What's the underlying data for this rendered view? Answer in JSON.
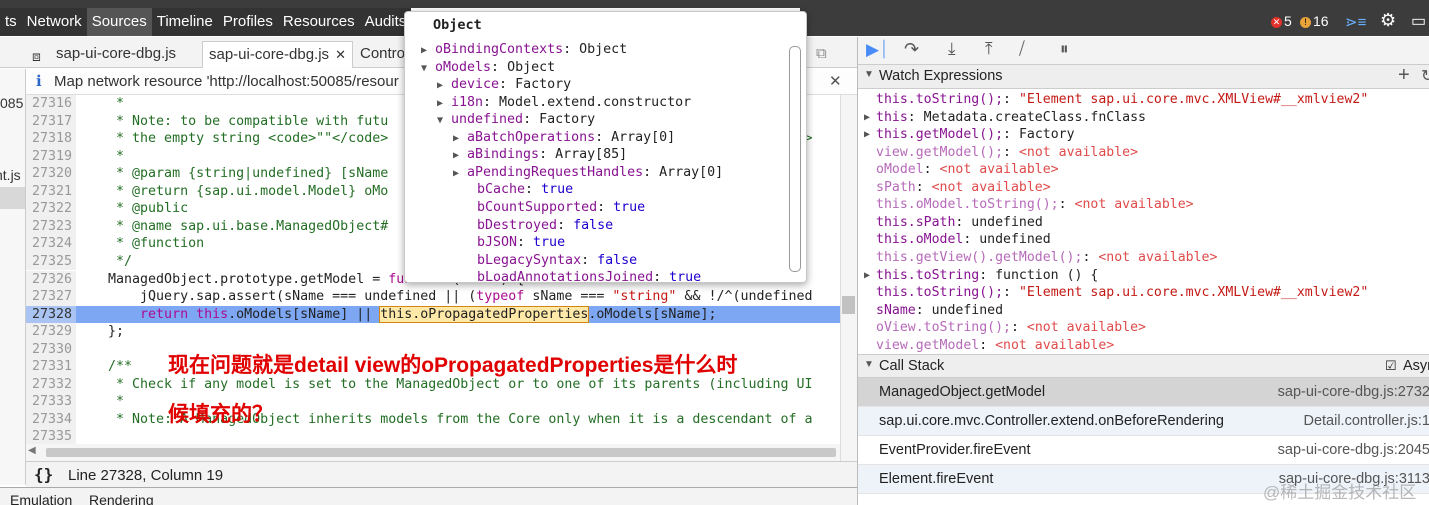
{
  "devtools": {
    "tabs": [
      {
        "label": "ts"
      },
      {
        "label": "Network"
      },
      {
        "label": "Sources"
      },
      {
        "label": "Timeline"
      },
      {
        "label": "Profiles"
      },
      {
        "label": "Resources"
      },
      {
        "label": "Audits"
      }
    ],
    "errors_count": "5",
    "warnings_count": "16"
  },
  "editor": {
    "file_tabs": [
      {
        "label": "sap-ui-core-dbg.js"
      },
      {
        "label": "sap-ui-core-dbg.js"
      },
      {
        "label": "Contro"
      }
    ],
    "infobar_text": "Map network resource 'http://localhost:50085/resour",
    "navigator_fragments": [
      "085",
      "nt.js"
    ],
    "status_text": "Line 27328, Column 19",
    "format_label": "{}",
    "drawer_tabs": [
      "Emulation",
      "Rendering"
    ]
  },
  "code_lines": [
    {
      "n": "27316",
      "parts": [
        [
          "c-com",
          "     *"
        ]
      ]
    },
    {
      "n": "27317",
      "parts": [
        [
          "c-com",
          "     * Note: to be compatible with futu"
        ],
        [
          "c-com",
          "                                                e th"
        ]
      ]
    },
    {
      "n": "27318",
      "parts": [
        [
          "c-com",
          "     * the empty string <code>\"\"</code>"
        ],
        [
          "c-com",
          "                                                code>"
        ]
      ]
    },
    {
      "n": "27319",
      "parts": [
        [
          "c-com",
          "     *"
        ]
      ]
    },
    {
      "n": "27320",
      "parts": [
        [
          "c-com",
          "     * @param {string|undefined} [sName"
        ]
      ]
    },
    {
      "n": "27321",
      "parts": [
        [
          "c-com",
          "     * @return {sap.ui.model.Model} oMo"
        ]
      ]
    },
    {
      "n": "27322",
      "parts": [
        [
          "c-com",
          "     * @public"
        ]
      ]
    },
    {
      "n": "27323",
      "parts": [
        [
          "c-com",
          "     * @name sap.ui.base.ManagedObject#"
        ]
      ]
    },
    {
      "n": "27324",
      "parts": [
        [
          "c-com",
          "     * @function"
        ]
      ]
    },
    {
      "n": "27325",
      "parts": [
        [
          "c-com",
          "     */"
        ]
      ]
    },
    {
      "n": "27326",
      "parts": [
        [
          "c-def",
          "    ManagedObject.prototype.getModel = "
        ],
        [
          "c-kw",
          "function"
        ],
        [
          "c-def",
          "(sName) {"
        ]
      ]
    },
    {
      "n": "27327",
      "parts": [
        [
          "c-def",
          "        jQuery.sap.assert(sName === undefined || ("
        ],
        [
          "c-kw",
          "typeof"
        ],
        [
          "c-def",
          " sName === "
        ],
        [
          "c-str",
          "\"string\""
        ],
        [
          "c-def",
          " && !/^(undefined"
        ]
      ]
    },
    {
      "n": "27328",
      "parts": [
        [
          "c-kw",
          "        return "
        ],
        [
          "c-kw",
          "this"
        ],
        [
          "c-def",
          ".oModels[sName] || "
        ],
        [
          "boxed",
          "this.oPropagatedProperties"
        ],
        [
          "c-def",
          ".oModels[sName];"
        ]
      ],
      "hl": "true"
    },
    {
      "n": "27329",
      "parts": [
        [
          "c-def",
          "    };"
        ]
      ]
    },
    {
      "n": "27330",
      "parts": [
        [
          "c-def",
          ""
        ]
      ]
    },
    {
      "n": "27331",
      "parts": [
        [
          "c-com",
          "    /**"
        ]
      ]
    },
    {
      "n": "27332",
      "parts": [
        [
          "c-com",
          "     * Check if any model is set to the ManagedObject or to one of its parents (including UI"
        ]
      ]
    },
    {
      "n": "27333",
      "parts": [
        [
          "c-com",
          "     *"
        ]
      ]
    },
    {
      "n": "27334",
      "parts": [
        [
          "c-com",
          "     * Note: A ManagedObject inherits models from the Core only when it is a descendant of a"
        ]
      ]
    },
    {
      "n": "27335",
      "parts": [
        [
          "c-com",
          ""
        ]
      ]
    }
  ],
  "popover": {
    "title": "Object",
    "rows": [
      {
        "tri": "▶",
        "key": "oBindingContexts",
        "sep": ": ",
        "val": "Object",
        "vcls": "v"
      },
      {
        "tri": "▼",
        "key": "oModels",
        "sep": ": ",
        "val": "Object",
        "vcls": "v"
      },
      {
        "tri": "▶",
        "key": "device",
        "sep": ": ",
        "val": "Factory",
        "vcls": "v"
      },
      {
        "tri": "▶",
        "key": "i18n",
        "sep": ": ",
        "val": "Model.extend.constructor",
        "vcls": "v"
      },
      {
        "tri": "▼",
        "key": "undefined",
        "sep": ": ",
        "val": "Factory",
        "vcls": "v"
      },
      {
        "tri": "▶",
        "key": "aBatchOperations",
        "sep": ": ",
        "val": "Array[0]",
        "vcls": "v"
      },
      {
        "tri": "▶",
        "key": "aBindings",
        "sep": ": ",
        "val": "Array[85]",
        "vcls": "v"
      },
      {
        "tri": "▶",
        "key": "aPendingRequestHandles",
        "sep": ": ",
        "val": "Array[0]",
        "vcls": "v"
      },
      {
        "tri": "",
        "key": "bCache",
        "sep": ": ",
        "val": "true",
        "vcls": "vb"
      },
      {
        "tri": "",
        "key": "bCountSupported",
        "sep": ": ",
        "val": "true",
        "vcls": "vb"
      },
      {
        "tri": "",
        "key": "bDestroyed",
        "sep": ": ",
        "val": "false",
        "vcls": "vb"
      },
      {
        "tri": "",
        "key": "bJSON",
        "sep": ": ",
        "val": "true",
        "vcls": "vb"
      },
      {
        "tri": "",
        "key": "bLegacySyntax",
        "sep": ": ",
        "val": "false",
        "vcls": "vb"
      },
      {
        "tri": "",
        "key": "bLoadAnnotationsJoined",
        "sep": ": ",
        "val": "true",
        "vcls": "vb"
      }
    ]
  },
  "watch": {
    "title": "Watch Expressions",
    "add_label": "+",
    "rows": [
      {
        "arrow": "",
        "key": "this.toString();",
        "sep": ": ",
        "val": "\"Element sap.ui.core.mvc.XMLView#__xmlview2\"",
        "kind": "str",
        "gray": "false"
      },
      {
        "arrow": "▶",
        "key": "this",
        "sep": ": ",
        "val": "Metadata.createClass.fnClass",
        "kind": "v",
        "gray": "false"
      },
      {
        "arrow": "▶",
        "key": "this.getModel();",
        "sep": ": ",
        "val": "Factory",
        "kind": "v",
        "gray": "false"
      },
      {
        "arrow": "",
        "key": "view.getModel();",
        "sep": ": ",
        "val": "<not available>",
        "kind": "na",
        "gray": "true"
      },
      {
        "arrow": "",
        "key": "oModel",
        "sep": ": ",
        "val": "<not available>",
        "kind": "na",
        "gray": "true"
      },
      {
        "arrow": "",
        "key": "sPath",
        "sep": ": ",
        "val": "<not available>",
        "kind": "na",
        "gray": "true"
      },
      {
        "arrow": "",
        "key": "this.oModel.toString();",
        "sep": ": ",
        "val": "<not available>",
        "kind": "na",
        "gray": "true"
      },
      {
        "arrow": "",
        "key": "this.sPath",
        "sep": ": ",
        "val": "undefined",
        "kind": "v",
        "gray": "false"
      },
      {
        "arrow": "",
        "key": "this.oModel",
        "sep": ": ",
        "val": "undefined",
        "kind": "v",
        "gray": "false"
      },
      {
        "arrow": "",
        "key": "this.getView().getModel();",
        "sep": ": ",
        "val": "<not available>",
        "kind": "na",
        "gray": "true"
      },
      {
        "arrow": "▶",
        "key": "this.toString",
        "sep": ": ",
        "val": "function () {",
        "kind": "v",
        "gray": "false"
      },
      {
        "arrow": "",
        "key": "this.toString();",
        "sep": ": ",
        "val": "\"Element sap.ui.core.mvc.XMLView#__xmlview2\"",
        "kind": "str",
        "gray": "false"
      },
      {
        "arrow": "",
        "key": "sName",
        "sep": ": ",
        "val": "undefined",
        "kind": "v",
        "gray": "false"
      },
      {
        "arrow": "",
        "key": "oView.toString();",
        "sep": ": ",
        "val": "<not available>",
        "kind": "na",
        "gray": "true"
      },
      {
        "arrow": "",
        "key": "view.getModel",
        "sep": ": ",
        "val": "<not available>",
        "kind": "na",
        "gray": "true"
      }
    ]
  },
  "callstack": {
    "title": "Call Stack",
    "async_label": "Asyn",
    "frames": [
      {
        "fn": "ManagedObject.getModel",
        "loc": "sap-ui-core-dbg.js:2732",
        "bg": "#d4d4d4"
      },
      {
        "fn": "sap.ui.core.mvc.Controller.extend.onBeforeRendering",
        "loc": "Detail.controller.js:1",
        "bg": "#eef3fa"
      },
      {
        "fn": "EventProvider.fireEvent",
        "loc": "sap-ui-core-dbg.js:2045",
        "bg": "#ffffff"
      },
      {
        "fn": "Element.fireEvent",
        "loc": "sap-ui-core-dbg.js:3113",
        "bg": "#eef3fa"
      }
    ]
  },
  "annotation": {
    "line1": "现在问题就是detail view的oPropagatedProperties是什么时",
    "line2": "候填充的？"
  },
  "watermark": "@稀土掘金技术社区",
  "colors": {
    "error": "#e0312a",
    "warning": "#e8a33a",
    "accent": "#4a8cf7",
    "annotation": "#e00000"
  }
}
